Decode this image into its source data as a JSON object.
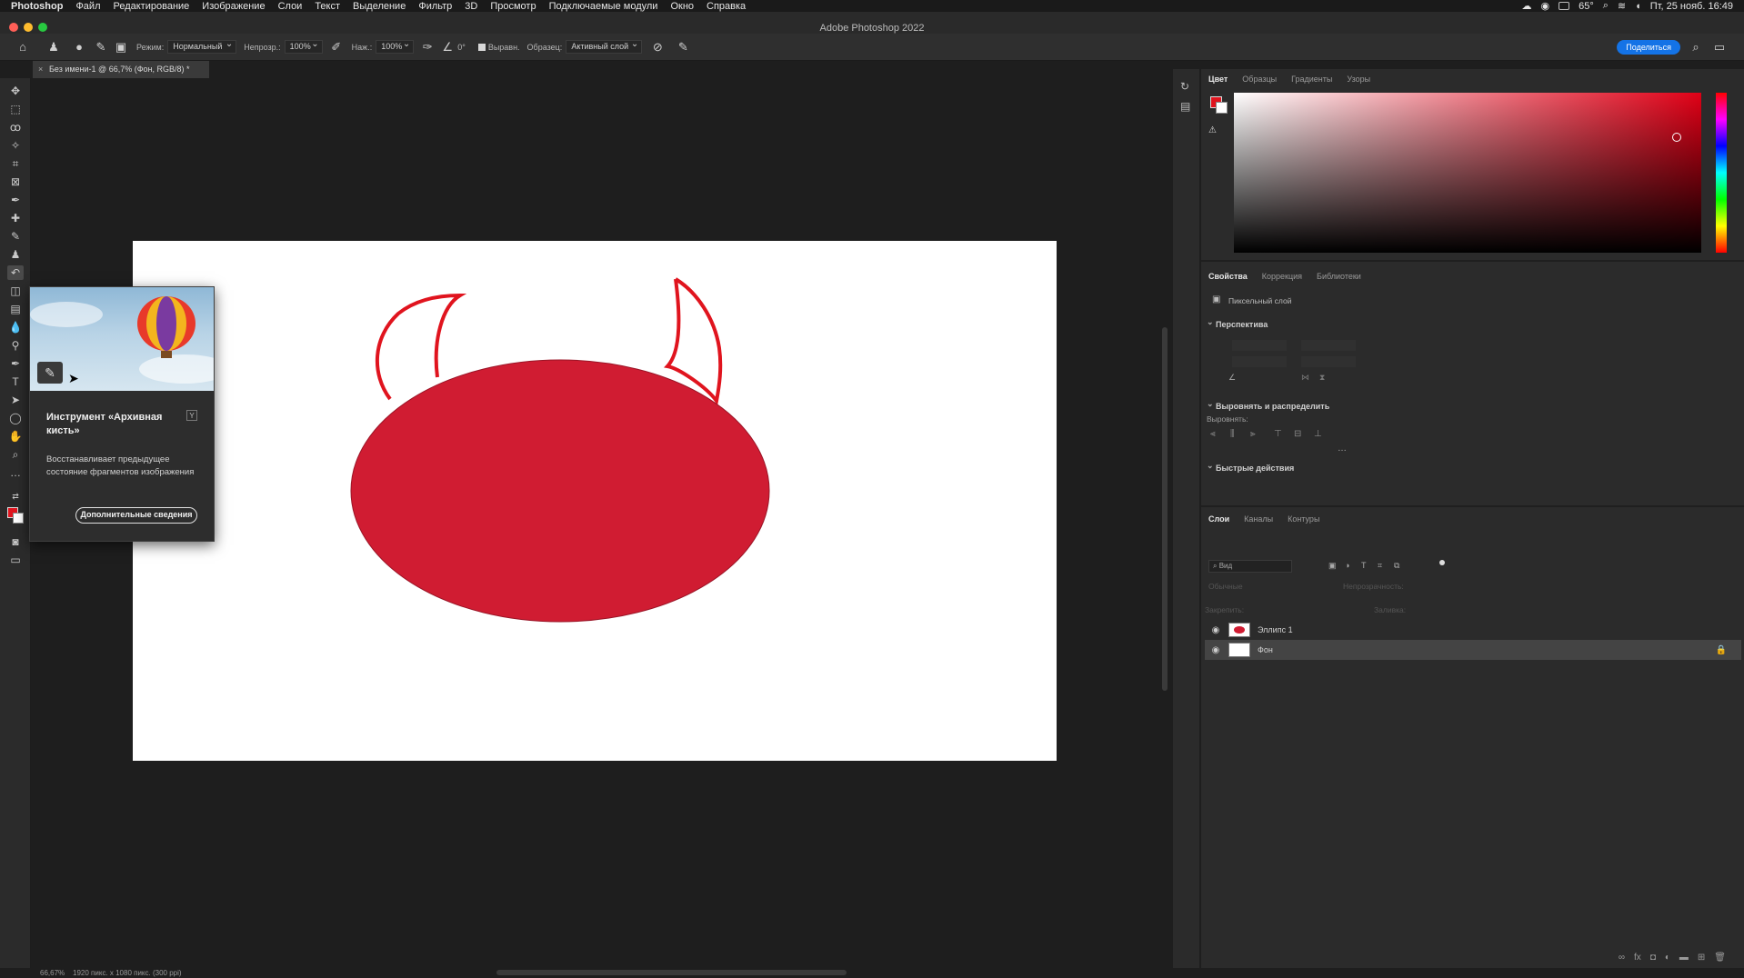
{
  "menubar": {
    "app": "Photoshop",
    "items": [
      "Файл",
      "Редактирование",
      "Изображение",
      "Слои",
      "Текст",
      "Выделение",
      "Фильтр",
      "3D",
      "Просмотр",
      "Подключаемые модули",
      "Окно",
      "Справка"
    ],
    "temperature": "65°",
    "clock": "Пт, 25 нояб. 16:49"
  },
  "window": {
    "title": "Adobe Photoshop 2022"
  },
  "options": {
    "mode_label": "Режим:",
    "mode_value": "Нормальный",
    "opacity_label": "Непрозр.:",
    "opacity_value": "100%",
    "pressure_label": "Наж.:",
    "pressure_value": "100%",
    "angle_value": "0°",
    "aligned_label": "Выравн.",
    "sample_label": "Образец:",
    "sample_value": "Активный слой",
    "share": "Поделиться"
  },
  "document": {
    "tab": "Без имени-1 @ 66,7% (Фон, RGB/8) *"
  },
  "tooltip": {
    "title": "Инструмент «Архивная кисть»",
    "shortcut": "Y",
    "description": "Восстанавливает предыдущее состояние фрагментов изображения",
    "button": "Дополнительные сведения"
  },
  "colors": {
    "foreground": "#e0141e",
    "background": "#ffffff",
    "ellipse": "#d01c32"
  },
  "color_panel": {
    "tabs": [
      "Цвет",
      "Образцы",
      "Градиенты",
      "Узоры"
    ]
  },
  "properties_panel": {
    "tabs": [
      "Свойства",
      "Коррекция",
      "Библиотеки"
    ],
    "layer_type": "Пиксельный слой",
    "perspective": "Перспектива",
    "align_section": "Выровнять и распределить",
    "align_label": "Выровнять:",
    "quick_actions": "Быстрые действия"
  },
  "layers_panel": {
    "tabs": [
      "Слои",
      "Каналы",
      "Контуры"
    ],
    "filter": "Вид",
    "blend": "Обычные",
    "opacity_label": "Непрозрачность:",
    "lock_label": "Закрепить:",
    "fill_label": "Заливка:",
    "layers": [
      {
        "name": "Эллипс 1",
        "selected": false
      },
      {
        "name": "Фон",
        "selected": true
      }
    ]
  },
  "status": {
    "zoom": "66,67%",
    "info": "1920 пикс. x 1080 пикс. (300 ppi)"
  }
}
